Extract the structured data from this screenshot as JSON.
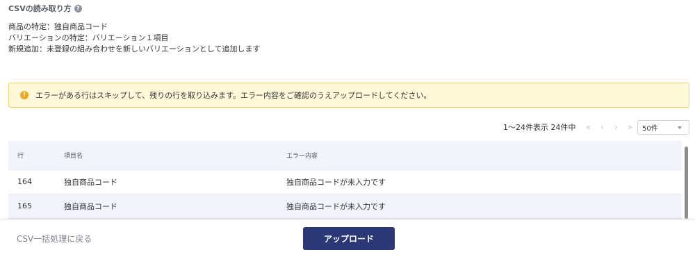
{
  "section": {
    "title": "CSVの読み取り方",
    "help_glyph": "?"
  },
  "rules": [
    "商品の特定：独自商品コード",
    "バリエーションの特定：バリエーション１項目",
    "新規追加：未登録の組み合わせを新しいバリエーションとして追加します"
  ],
  "alert": {
    "icon_glyph": "!",
    "text": "エラーがある行はスキップして、残りの行を取り込みます。エラー内容をご確認のうえアップロードしてください。"
  },
  "pager": {
    "summary": "1〜24件表示 24件中",
    "first": "«",
    "prev": "‹",
    "next": "›",
    "last": "»",
    "per_page": "50件"
  },
  "table": {
    "headers": [
      "行",
      "項目名",
      "エラー内容"
    ],
    "rows": [
      [
        "164",
        "独自商品コード",
        "独自商品コードが未入力です"
      ],
      [
        "165",
        "独自商品コード",
        "独自商品コードが未入力です"
      ]
    ]
  },
  "footer": {
    "back_label": "CSV一括処理に戻る",
    "upload_label": "アップロード"
  },
  "colors": {
    "primary": "#2c3775",
    "alert_bg": "#fff8d9",
    "alert_border": "#f1ce67",
    "warn_icon": "#f2a51e"
  }
}
